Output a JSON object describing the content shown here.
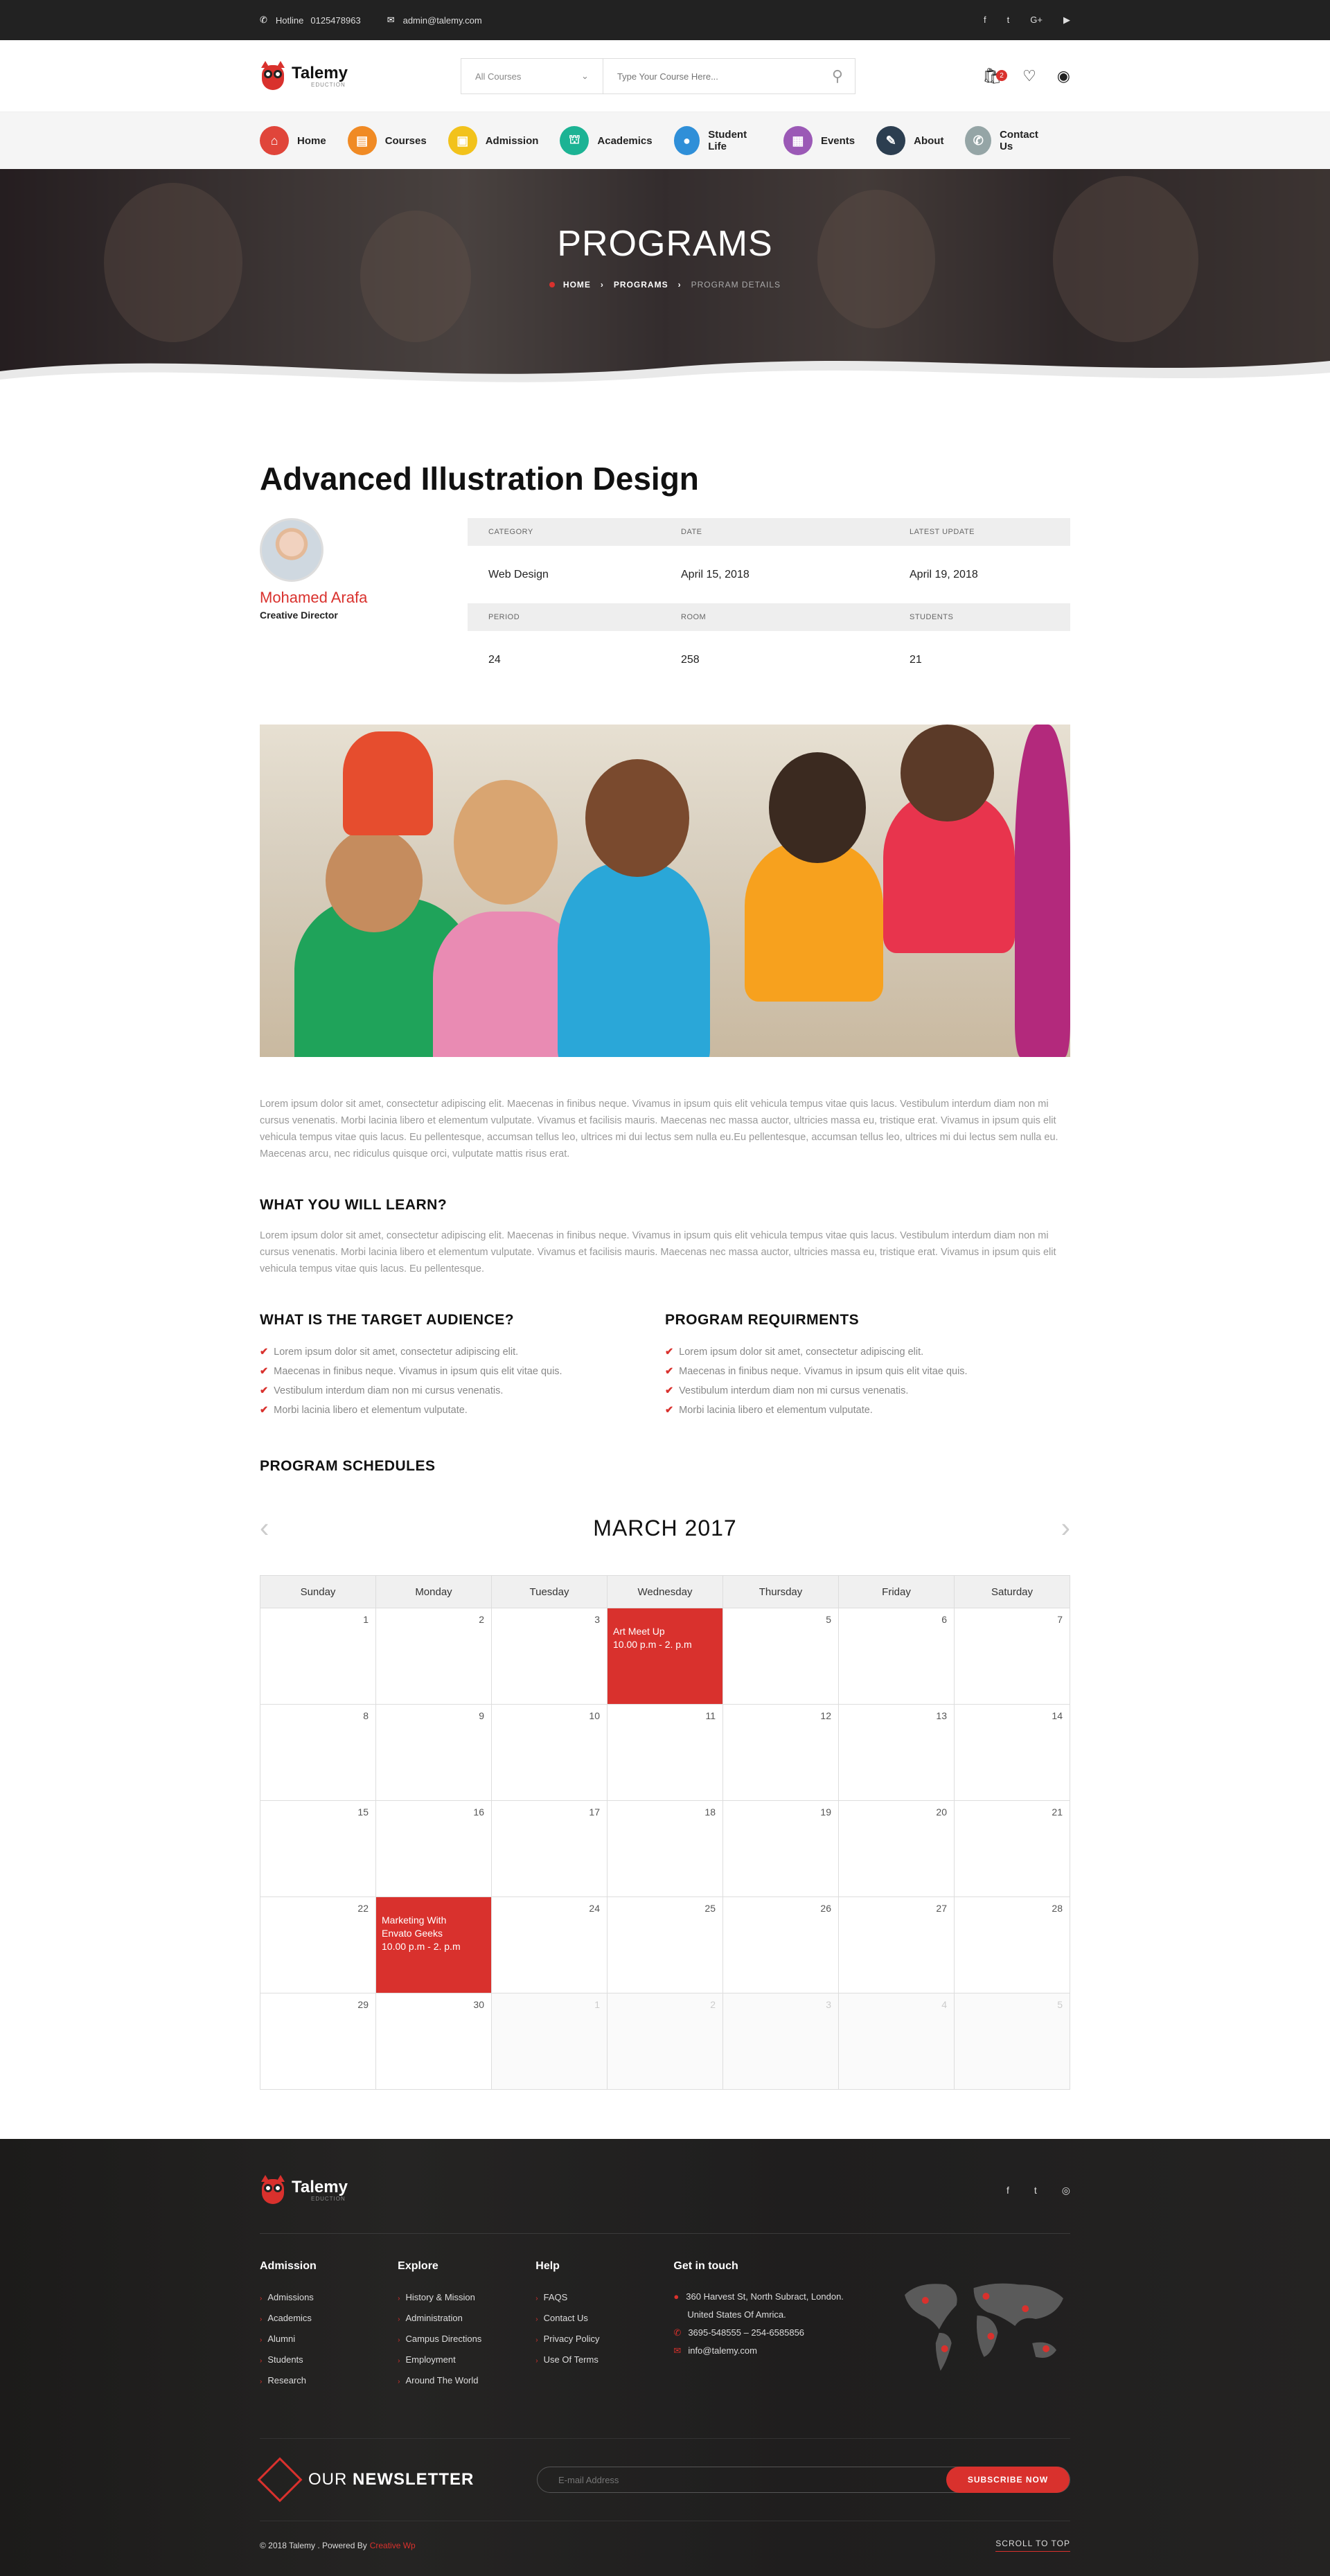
{
  "topbar": {
    "hotline_label": "Hotline",
    "hotline_number": "0125478963",
    "email": "admin@talemy.com",
    "social": [
      "f",
      "t",
      "G+",
      "▶"
    ]
  },
  "header": {
    "logo_name": "Talemy",
    "logo_sub": "EDUCTION",
    "category_select": "All Courses",
    "search_placeholder": "Type Your Course Here...",
    "cart_count": "2"
  },
  "nav": [
    {
      "label": "Home",
      "color": "#e0453a",
      "icon": "⌂"
    },
    {
      "label": "Courses",
      "color": "#f08a24",
      "icon": "▤"
    },
    {
      "label": "Admission",
      "color": "#f2c21b",
      "icon": "▣"
    },
    {
      "label": "Academics",
      "color": "#1cb394",
      "icon": "⛫"
    },
    {
      "label": "Student Life",
      "color": "#2f8fd8",
      "icon": "●"
    },
    {
      "label": "Events",
      "color": "#9b59b6",
      "icon": "▦"
    },
    {
      "label": "About",
      "color": "#2c3e50",
      "icon": "✎"
    },
    {
      "label": "Contact Us",
      "color": "#95a5a6",
      "icon": "✆"
    }
  ],
  "hero": {
    "title": "PROGRAMS",
    "crumb_home": "HOME",
    "crumb_programs": "PROGRAMS",
    "crumb_current": "PROGRAM DETAILS"
  },
  "program": {
    "title": "Advanced Illustration Design",
    "author_name": "Mohamed Arafa",
    "author_role": "Creative Director",
    "info_headers_1": [
      "CATEGORY",
      "DATE",
      "LATEST UPDATE"
    ],
    "info_values_1": [
      "Web Design",
      "April 15, 2018",
      "April 19, 2018"
    ],
    "info_headers_2": [
      "PERIOD",
      "ROOM",
      "STUDENTS"
    ],
    "info_values_2": [
      "24",
      "258",
      "21"
    ],
    "intro": "Lorem ipsum dolor sit amet, consectetur adipiscing elit. Maecenas in finibus neque. Vivamus in ipsum quis elit vehicula tempus vitae quis lacus. Vestibulum interdum diam non mi cursus venenatis. Morbi lacinia libero et elementum vulputate. Vivamus et facilisis mauris. Maecenas nec massa auctor, ultricies massa eu, tristique erat. Vivamus in ipsum quis elit vehicula tempus vitae quis lacus. Eu pellentesque, accumsan tellus leo, ultrices mi dui lectus sem nulla eu.Eu pellentesque, accumsan tellus leo, ultrices mi dui lectus sem nulla eu. Maecenas arcu, nec ridiculus quisque orci, vulputate mattis risus erat.",
    "learn_heading": "WHAT YOU WILL LEARN?",
    "learn_text": "Lorem ipsum dolor sit amet, consectetur adipiscing elit. Maecenas in finibus neque. Vivamus in ipsum quis elit vehicula tempus vitae quis lacus. Vestibulum interdum diam non mi cursus venenatis. Morbi lacinia libero et elementum vulputate. Vivamus et facilisis mauris. Maecenas nec massa auctor, ultricies massa eu, tristique erat. Vivamus in ipsum quis elit vehicula tempus vitae quis lacus. Eu pellentesque.",
    "audience_heading": "WHAT IS THE TARGET AUDIENCE?",
    "audience_items": [
      "Lorem ipsum dolor sit amet, consectetur adipiscing elit.",
      "Maecenas in finibus neque. Vivamus in ipsum quis elit vitae quis.",
      "Vestibulum interdum diam non mi cursus venenatis.",
      "Morbi lacinia libero et elementum vulputate."
    ],
    "req_heading": "PROGRAM REQUIRMENTS",
    "req_items": [
      "Lorem ipsum dolor sit amet, consectetur adipiscing elit.",
      "Maecenas in finibus neque. Vivamus in ipsum quis elit vitae quis.",
      "Vestibulum interdum diam non mi cursus venenatis.",
      "Morbi lacinia libero et elementum vulputate."
    ],
    "schedule_heading": "PROGRAM SCHEDULES"
  },
  "calendar": {
    "title": "MARCH 2017",
    "prev": "‹",
    "next": "›",
    "days": [
      "Sunday",
      "Monday",
      "Tuesday",
      "Wednesday",
      "Thursday",
      "Friday",
      "Saturday"
    ],
    "weeks": [
      [
        {
          "n": "1"
        },
        {
          "n": "2"
        },
        {
          "n": "3"
        },
        {
          "n": "",
          "event": [
            "Art Meet Up",
            "10.00 p.m - 2. p.m"
          ]
        },
        {
          "n": "5"
        },
        {
          "n": "6"
        },
        {
          "n": "7"
        }
      ],
      [
        {
          "n": "8"
        },
        {
          "n": "9"
        },
        {
          "n": "10"
        },
        {
          "n": "11"
        },
        {
          "n": "12"
        },
        {
          "n": "13"
        },
        {
          "n": "14"
        }
      ],
      [
        {
          "n": "15"
        },
        {
          "n": "16"
        },
        {
          "n": "17"
        },
        {
          "n": "18"
        },
        {
          "n": "19"
        },
        {
          "n": "20"
        },
        {
          "n": "21"
        }
      ],
      [
        {
          "n": "22"
        },
        {
          "n": "",
          "event": [
            "Marketing With",
            "Envato Geeks",
            "10.00 p.m - 2. p.m"
          ]
        },
        {
          "n": "24"
        },
        {
          "n": "25"
        },
        {
          "n": "26"
        },
        {
          "n": "27"
        },
        {
          "n": "28"
        }
      ],
      [
        {
          "n": "29"
        },
        {
          "n": "30"
        },
        {
          "n": "1",
          "other": true
        },
        {
          "n": "2",
          "other": true
        },
        {
          "n": "3",
          "other": true
        },
        {
          "n": "4",
          "other": true
        },
        {
          "n": "5",
          "other": true
        }
      ]
    ]
  },
  "footer": {
    "logo_name": "Talemy",
    "logo_sub": "EDUCTION",
    "social": [
      "f",
      "t",
      "◎"
    ],
    "admission_heading": "Admission",
    "admission_links": [
      "Admissions",
      "Academics",
      "Alumni",
      "Students",
      "Research"
    ],
    "explore_heading": "Explore",
    "explore_links": [
      "History & Mission",
      "Administration",
      "Campus Directions",
      "Employment",
      "Around The World"
    ],
    "help_heading": "Help",
    "help_links": [
      "FAQS",
      "Contact Us",
      "Privacy Policy",
      "Use Of Terms"
    ],
    "contact_heading": "Get in touch",
    "address_1": "360 Harvest St, North Subract, London.",
    "address_2": "United States Of Amrica.",
    "phones": "3695-548555    –    254-6585856",
    "email": "info@talemy.com",
    "newsletter_light": "OUR",
    "newsletter_bold": "NEWSLETTER",
    "newsletter_placeholder": "E-mail Address",
    "subscribe_label": "SUBSCRIBE NOW",
    "copyright": "© 2018 Talemy . Powered By",
    "powered": "Creative Wp",
    "scroll_top": "SCROLL TO TOP"
  }
}
